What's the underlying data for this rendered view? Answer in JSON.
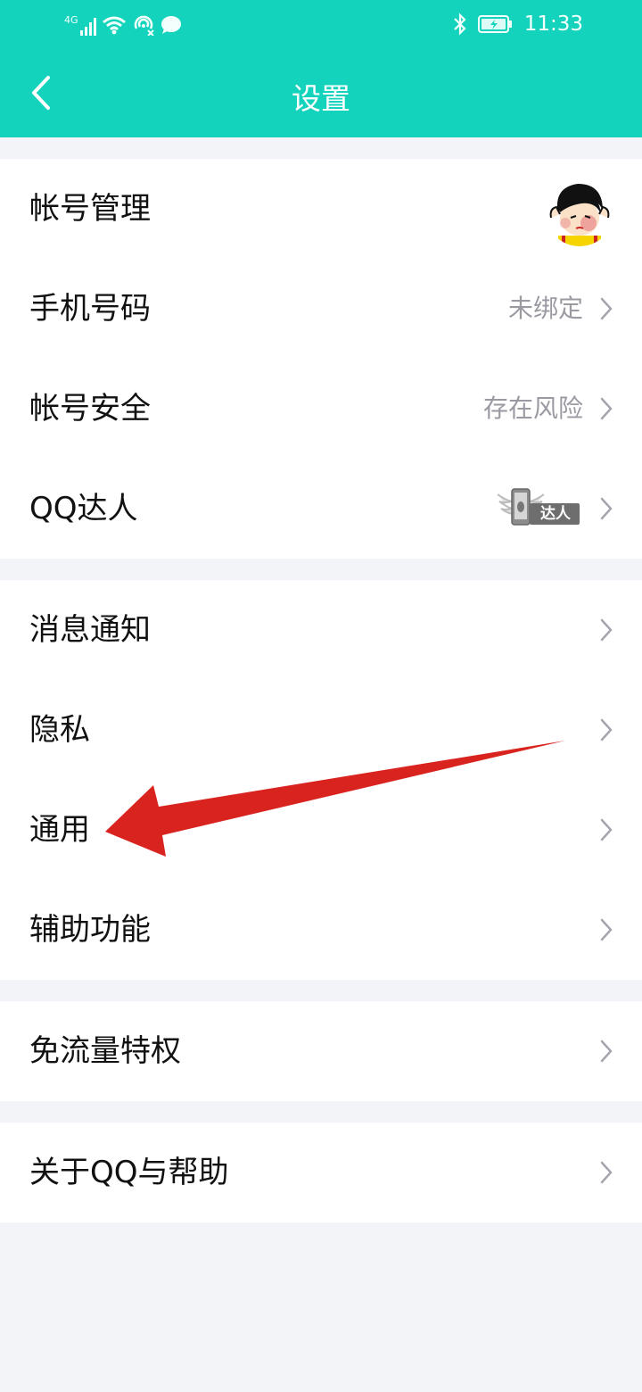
{
  "status_bar": {
    "network": "4G",
    "time": "11:33"
  },
  "header": {
    "title": "设置"
  },
  "groups": [
    {
      "items": [
        {
          "label": "帐号管理",
          "value": ""
        },
        {
          "label": "手机号码",
          "value": "未绑定"
        },
        {
          "label": "帐号安全",
          "value": "存在风险"
        },
        {
          "label": "QQ达人",
          "value": "",
          "badge_text": "达人"
        }
      ]
    },
    {
      "items": [
        {
          "label": "消息通知"
        },
        {
          "label": "隐私"
        },
        {
          "label": "通用"
        },
        {
          "label": "辅助功能"
        }
      ]
    },
    {
      "items": [
        {
          "label": "免流量特权"
        }
      ]
    },
    {
      "items": [
        {
          "label": "关于QQ与帮助"
        }
      ]
    }
  ],
  "colors": {
    "header_bg": "#14d3bc",
    "page_bg": "#f3f4f8",
    "annotation_arrow": "#d9231f"
  },
  "icons": [
    "signal-icon",
    "wifi-icon",
    "hotspot-icon",
    "chat-bubble-icon",
    "bluetooth-icon",
    "battery-icon",
    "back-icon",
    "chevron-right-icon",
    "avatar",
    "qq-daren-badge-icon"
  ]
}
